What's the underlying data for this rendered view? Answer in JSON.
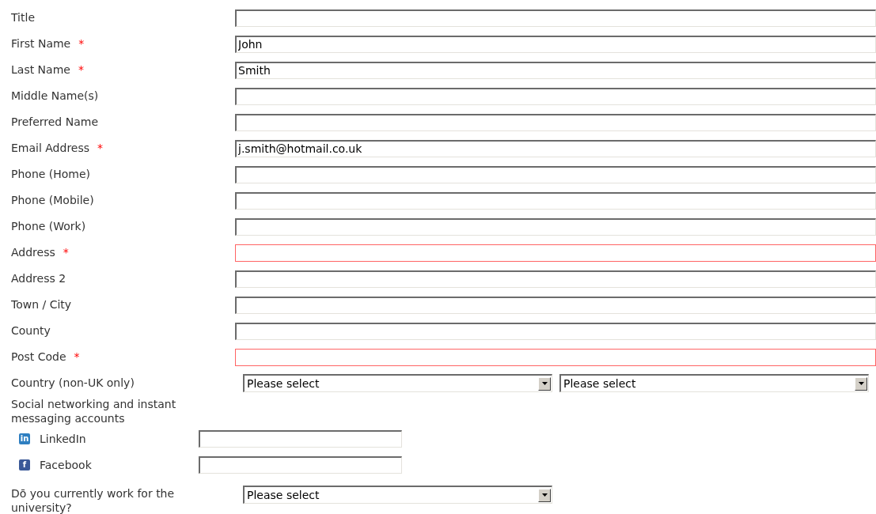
{
  "fields": [
    {
      "label": "Title",
      "required": false,
      "error": false
    },
    {
      "label": "First Name",
      "required": true,
      "error": false,
      "value": "John"
    },
    {
      "label": "Last Name",
      "required": true,
      "error": false,
      "value": "Smith"
    },
    {
      "label": "Middle Name(s)",
      "required": false,
      "error": false
    },
    {
      "label": "Preferred Name",
      "required": false,
      "error": false
    },
    {
      "label": "Email Address",
      "required": true,
      "error": false,
      "value": "j.smith@hotmail.co.uk"
    },
    {
      "label": "Phone (Home)",
      "required": false,
      "error": false
    },
    {
      "label": "Phone (Mobile)",
      "required": false,
      "error": false
    },
    {
      "label": "Phone (Work)",
      "required": false,
      "error": false
    },
    {
      "label": "Address",
      "required": true,
      "error": true
    },
    {
      "label": "Address 2",
      "required": false,
      "error": false
    },
    {
      "label": "Town / City",
      "required": false,
      "error": false
    },
    {
      "label": "County",
      "required": false,
      "error": false
    },
    {
      "label": "Post Code",
      "required": true,
      "error": true
    }
  ],
  "required_mark": "*",
  "country": {
    "label": "Country (non-UK only)",
    "selects": [
      {
        "value": "Please select"
      },
      {
        "value": "Please select"
      }
    ]
  },
  "social": {
    "heading": "Social networking and instant messaging accounts",
    "accounts": [
      {
        "kind": "linkedin",
        "label": "LinkedIn",
        "icon_text": "in"
      },
      {
        "kind": "facebook",
        "label": "Facebook",
        "icon_text": "f"
      }
    ]
  },
  "employment": {
    "label": "Dō you currently work for the university?",
    "select": {
      "value": "Please select"
    }
  }
}
